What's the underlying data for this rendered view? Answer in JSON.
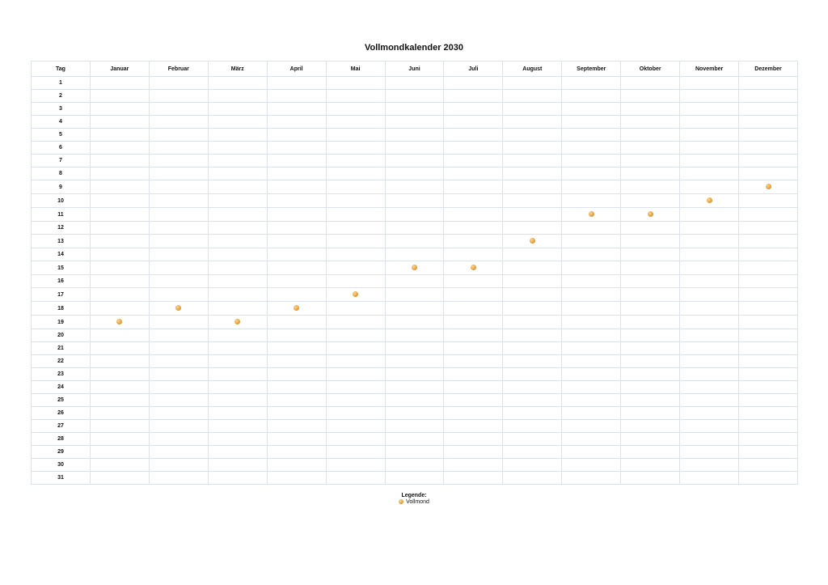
{
  "title": "Vollmondkalender 2030",
  "header_day": "Tag",
  "months": [
    "Januar",
    "Februar",
    "März",
    "April",
    "Mai",
    "Juni",
    "Juli",
    "August",
    "September",
    "Oktober",
    "November",
    "Dezember"
  ],
  "full_moon_days": [
    19,
    18,
    19,
    18,
    17,
    15,
    15,
    13,
    11,
    11,
    10,
    9
  ],
  "legend": {
    "title": "Legende:",
    "item_label": "Vollmond"
  },
  "colors": {
    "moon": "#e9a340",
    "grid": "#dde3ea"
  },
  "icons": {
    "full_moon": "full-moon-icon"
  }
}
